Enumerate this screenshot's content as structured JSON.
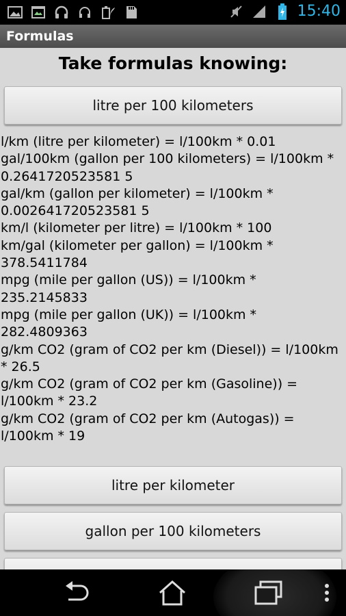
{
  "status_bar": {
    "time": "15:40",
    "icons_left": [
      "gallery-icon",
      "screenshot-icon",
      "headphones-icon",
      "headset-icon",
      "battery-leaf-icon",
      "sd-card-icon"
    ],
    "icons_right": [
      "mute-icon",
      "signal-icon",
      "battery-charging-icon"
    ],
    "time_color": "#33b5e5"
  },
  "action_bar": {
    "title": "Formulas"
  },
  "heading": "Take formulas knowing:",
  "buttons": {
    "l100km": "litre per 100 kilometers",
    "lkm": "litre per kilometer",
    "gal100km": "gallon per 100 kilometers"
  },
  "formulas": [
    "l/km (litre per kilometer) = l/100km * 0.01",
    "gal/100km (gallon per 100 kilometers) = l/100km * 0.2641720523581 5",
    "gal/km (gallon per kilometer) = l/100km * 0.002641720523581 5",
    "km/l (kilometer per litre) = l/100km * 100",
    "km/gal (kilometer per gallon) = l/100km * 378.5411784",
    "mpg (mile per gallon (US)) = l/100km * 235.2145833",
    "mpg (mile per gallon (UK)) = l/100km * 282.4809363",
    "g/km CO2 (gram of CO2 per km (Diesel)) = l/100km * 26.5",
    "g/km CO2 (gram of CO2 per km (Gasoline)) = l/100km * 23.2",
    "g/km CO2 (gram of CO2 per km (Autogas)) = l/100km * 19"
  ],
  "nav_bar": {
    "icons": [
      "back-icon",
      "home-icon",
      "recent-apps-icon",
      "overflow-menu-icon"
    ]
  }
}
